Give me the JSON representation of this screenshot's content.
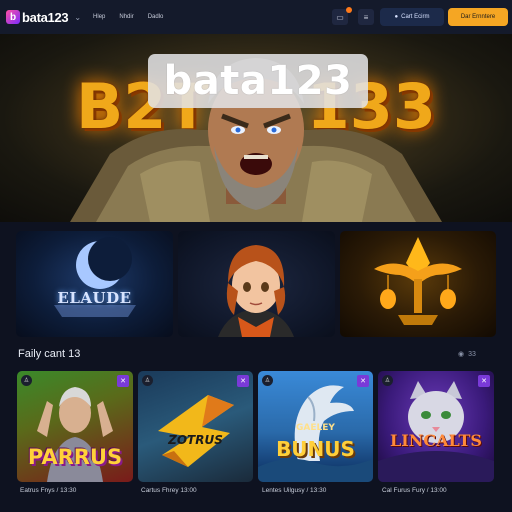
{
  "header": {
    "brand": "bata123",
    "nav": [
      "Hlep",
      "Nhdir",
      "Dadlo"
    ],
    "sign_in": "Cart Ecirm",
    "register": "Dar Ernntere"
  },
  "hero": {
    "title_left": "B2T",
    "title_right": "133",
    "overlay": "bata123"
  },
  "tiles": [
    {
      "label": "ELAUDE"
    },
    {
      "label": ""
    },
    {
      "label": ""
    }
  ],
  "section": {
    "title": "Faily cant 13",
    "more": "33"
  },
  "cards": [
    {
      "title": "PARRUS",
      "caption": "Eatrus Fnys / 13:30"
    },
    {
      "title": "ZOTRUS",
      "caption": "Cartus Fhrey  13:00"
    },
    {
      "title": "BUNUS",
      "subtitle": "GAELEY",
      "caption": "Lentes Uilgusy / 13:30"
    },
    {
      "title": "LINCALTS",
      "caption": "Cal Furus Fury / 13:00"
    }
  ],
  "colors": {
    "accent": "#f5a623",
    "background": "#0e1220",
    "topbar": "#141a2b",
    "tag": "#7a3ad8"
  }
}
